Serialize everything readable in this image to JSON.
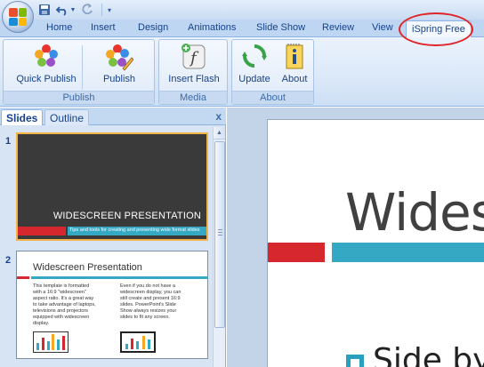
{
  "ribbon_tabs": [
    "Home",
    "Insert",
    "Design",
    "Animations",
    "Slide Show",
    "Review",
    "View",
    "iSpring Free"
  ],
  "ribbon": {
    "publish_group": {
      "label": "Publish",
      "quick_publish": "Quick Publish",
      "publish": "Publish"
    },
    "media_group": {
      "label": "Media",
      "insert_flash": "Insert Flash"
    },
    "about_group": {
      "label": "About",
      "update": "Update",
      "about": "About"
    }
  },
  "pane": {
    "tab_slides": "Slides",
    "tab_outline": "Outline",
    "close": "x"
  },
  "slides": [
    {
      "number": "1",
      "title": "WIDESCREEN PRESENTATION",
      "subtitle": "Tips and tools for creating and presenting wide format slides"
    },
    {
      "number": "2",
      "title": "Widescreen Presentation",
      "col1": "This template is formatted with a 16:9 \"widescreen\" aspect ratio. It's a great way to take advantage of laptops, televisions and projectors equipped with widescreen display.",
      "col2": "Even if you do not have a widescreen display, you can still create and present 16:9 slides. PowerPoint's Slide Show always resizes your slides to fit any screen."
    }
  ],
  "main_slide": {
    "title_partial": "Wides",
    "subtitle_partial": "Side by"
  },
  "colors": {
    "red_bar": "#d7272e",
    "teal_bar": "#35a8c4",
    "highlight": "#e0242a"
  }
}
